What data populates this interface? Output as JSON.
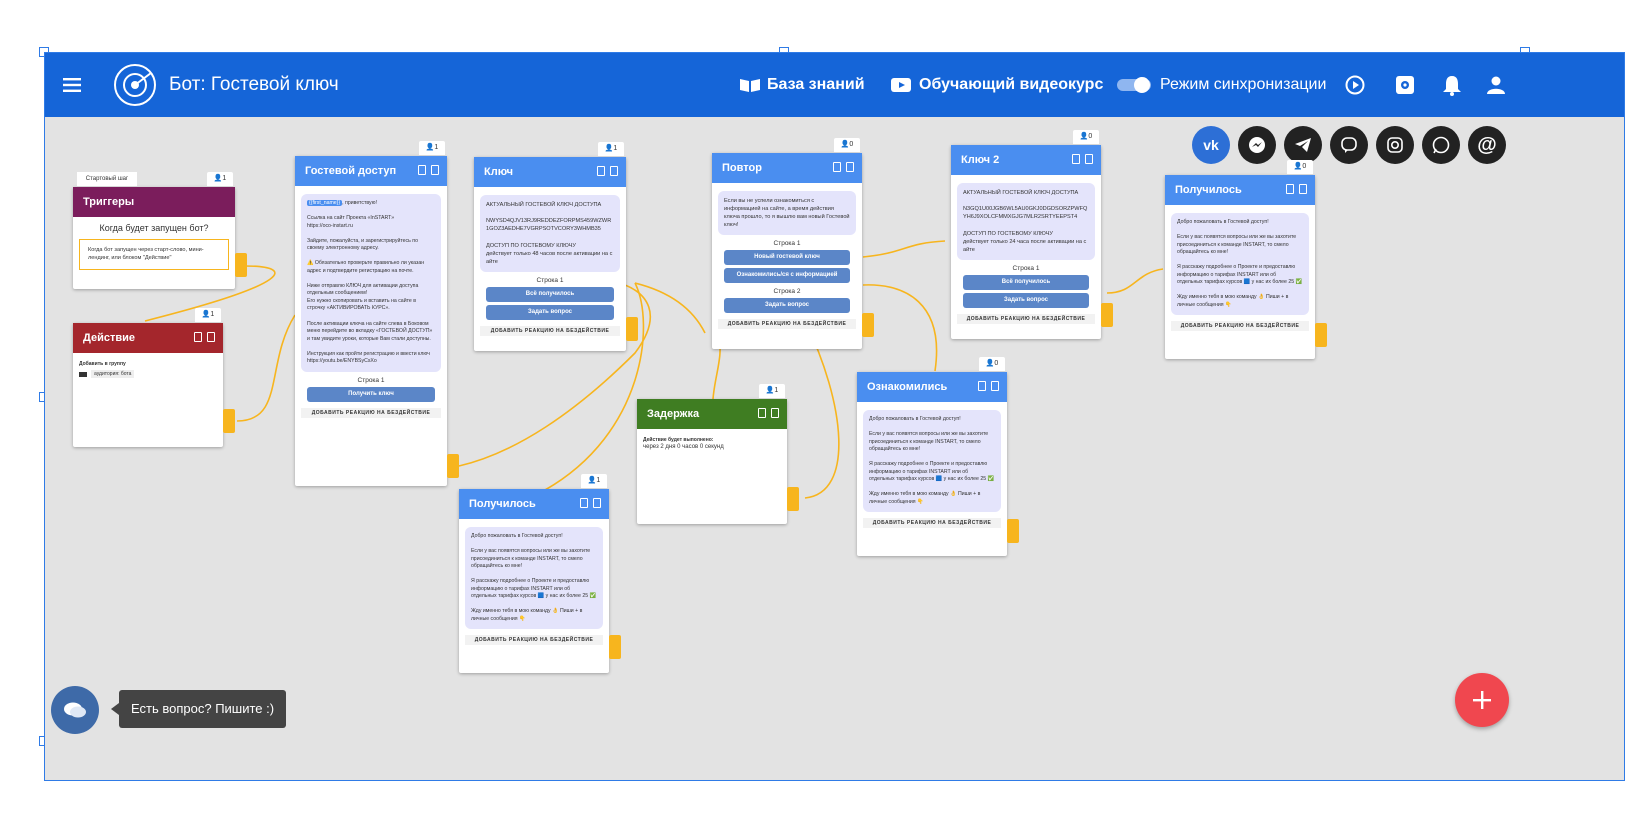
{
  "header": {
    "bot_title": "Бот: Гостевой ключ",
    "knowledge_base": "База знаний",
    "video_course": "Обучающий видеокурс",
    "sync_mode": "Режим синхронизации"
  },
  "social": [
    "vk",
    "messenger",
    "telegram",
    "viber",
    "instagram",
    "whatsapp",
    "email"
  ],
  "social_labels": {
    "vk": "vk",
    "email": "@"
  },
  "start_step": {
    "tag": "Стартовый шаг",
    "count": "1",
    "title": "Триггеры",
    "question": "Когда будет запущен бот?",
    "desc": "Когда бот запущен через старт-слово, мини-лендинг, или блоком \"Действие\""
  },
  "action": {
    "count": "1",
    "title": "Действие",
    "sub": "Добавить в группу",
    "tag": "аудитория: бота"
  },
  "guest": {
    "count": "1",
    "title": "Гостевой доступ",
    "chip": "{{first_name}}",
    "text": ", приветствую!\n\nСсылка на сайт Проекта «InSTART»\nhttps://oco-instart.ru\n\nЗайдите, пожалуйста, и зарегистрируйтесь по своему электронному адресу.\n\n⚠️ Обязательно проверьте правильно ли указан адрес и подтвердите регистрацию на почте.\n\nНиже отправлю КЛЮЧ для активации доступа отдельным сообщением!\nЕго нужно скопировать и вставить на сайте в строчку «АКТИВИРОВАТЬ КУРС».\n\nПосле активации ключа на сайте слева в Боковом меню перейдите во вкладку «ГОСТЕВОЙ ДОСТУП» и там увидите уроки, которые Вам стали доступны.\n\nИнструкция как пройти регистрацию и ввести ключ\nhttps://youtu.be/ENYBSyCsXo",
    "row": "Строка 1",
    "button": "Получить ключ",
    "react": "ДОБАВИТЬ РЕАКЦИЮ НА БЕЗДЕЙСТВИЕ"
  },
  "key1": {
    "count": "1",
    "title": "Ключ",
    "text": "АКТУАЛЬНЫЙ ГОСТЕВОЙ КЛЮЧ ДОСТУПА\n\nNWYSD4QJV13RJ9REDDEZFORPMS459WZWR1GOZ3AEDHE7VGRPSOTVCORY3WHMB35\n\nДОСТУП ПО ГОСТЕВОМУ КЛЮЧУ\nдействует только 48 часов после активации на сайте",
    "row": "Строка 1",
    "btn1": "Всё получилось",
    "btn2": "Задать вопрос",
    "react": "ДОБАВИТЬ РЕАКЦИЮ НА БЕЗДЕЙСТВИЕ"
  },
  "repeat": {
    "count": "0",
    "title": "Повтор",
    "text": "Если вы не успели ознакомиться с информацией на сайте, а время действия ключа прошло, то я вышлю вам новый Гостевой ключ!",
    "row1": "Строка 1",
    "btn1": "Новый гостевой ключ",
    "btn2": "Ознакомились/ся с информацией",
    "row2": "Строка 2",
    "btn3": "Задать вопрос",
    "react": "ДОБАВИТЬ РЕАКЦИЮ НА БЕЗДЕЙСТВИЕ"
  },
  "key2": {
    "count": "0",
    "title": "Ключ 2",
    "text": "АКТУАЛЬНЫЙ ГОСТЕВОЙ КЛЮЧ ДОСТУПА\n\nN3GQ1U00JGB6WL5AU0GKJ0DGDSORZPWFQYH6J9XOLCFMMXGJG7MLR2SRTYEEPST4\n\nДОСТУП ПО ГОСТЕВОМУ КЛЮЧУ\nдействует только 24 часа после активации на сайте",
    "row": "Строка 1",
    "btn1": "Всё получилось",
    "btn2": "Задать вопрос",
    "react": "ДОБАВИТЬ РЕАКЦИЮ НА БЕЗДЕЙСТВИЕ"
  },
  "success_right": {
    "count": "0",
    "title": "Получилось",
    "text": "Добро пожаловать в Гостевой доступ!\n\nЕсли у вас появятся вопросы или же вы захотите присоединиться к команде INSTART, то смело обращайтесь ко мне!\n\nЯ расскажу подробнее о Проекте и предоставлю информацию о тарифах INSTART или об отдельных тарифах курсов 🟦 у нас их более 25 ✅\n\nЖду именно тебя в мою команду 👌 Пиши + в личные сообщения 👇",
    "react": "ДОБАВИТЬ РЕАКЦИЮ НА БЕЗДЕЙСТВИЕ"
  },
  "delay": {
    "count": "1",
    "title": "Задержка",
    "line1": "Действие будет выполнено:",
    "line2": "через 2 дня 0 часов 0 секунд"
  },
  "success_mid": {
    "count": "1",
    "title": "Получилось",
    "text": "Добро пожаловать в Гостевой доступ!\n\nЕсли у вас появятся вопросы или же вы захотите присоединиться к команде INSTART, то смело обращайтесь ко мне!\n\nЯ расскажу подробнее о Проекте и предоставлю информацию о тарифах INSTART или об отдельных тарифах курсов 🟦 у нас их более 25 ✅\n\nЖду именно тебя в мою команду 👌 Пиши + в личные сообщения 👇",
    "react": "ДОБАВИТЬ РЕАКЦИЮ НА БЕЗДЕЙСТВИЕ"
  },
  "acquainted": {
    "count": "0",
    "title": "Ознакомились",
    "text": "Добро пожаловать в Гостевой доступ!\n\nЕсли у вас появятся вопросы или же вы захотите присоединиться к команде INSTART, то смело обращайтесь ко мне!\n\nЯ расскажу подробнее о Проекте и предоставлю информацию о тарифах INSTART или об отдельных тарифах курсов 🟦 у нас их более 25 ✅\n\nЖду именно тебя в мою команду 👌 Пиши + в личные сообщения 👇",
    "react": "ДОБАВИТЬ РЕАКЦИЮ НА БЕЗДЕЙСТВИЕ"
  },
  "chat": {
    "label": "Есть вопрос? Пишите :)"
  },
  "colors": {
    "header": "#1565d8",
    "card_header": "#4a8ef0",
    "trigger": "#7b1d5c",
    "action": "#a4262c",
    "delay": "#3f7d22",
    "connector": "#f7b51e",
    "fab": "#f0474f"
  }
}
